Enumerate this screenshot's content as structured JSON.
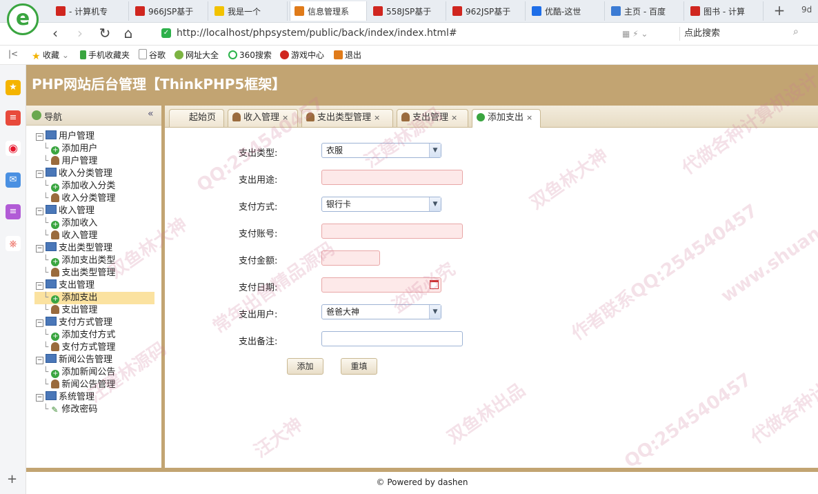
{
  "browser": {
    "tabs": [
      {
        "label": "- 计算机专",
        "color": "#d0261f",
        "active": false
      },
      {
        "label": "966JSP基于",
        "color": "#d0261f",
        "active": false
      },
      {
        "label": "我是一个",
        "color": "#f2c200",
        "active": false
      },
      {
        "label": "信息管理系",
        "color": "#e07b1a",
        "active": true
      },
      {
        "label": "558JSP基于",
        "color": "#d0261f",
        "active": false
      },
      {
        "label": "962JSP基于",
        "color": "#d0261f",
        "active": false
      },
      {
        "label": "优酷-这世",
        "color": "#1e6ee8",
        "active": false
      },
      {
        "label": "主页 - 百度",
        "color": "#3b7bd4",
        "active": false
      },
      {
        "label": "图书 - 计算",
        "color": "#d0261f",
        "active": false
      }
    ],
    "tab_extra": "9d",
    "url": "http://localhost/phpsystem/public/back/index/index.html#",
    "search_label": "点此搜索",
    "bookmarks": [
      "收藏",
      "手机收藏夹",
      "谷歌",
      "网址大全",
      "360搜索",
      "游戏中心",
      "退出"
    ]
  },
  "app": {
    "title": "PHP网站后台管理【ThinkPHP5框架】",
    "nav_title": "导航",
    "footer": "© Powered by dashen"
  },
  "tree": [
    {
      "label": "用户管理",
      "type": "group"
    },
    {
      "label": "添加用户",
      "type": "add"
    },
    {
      "label": "用户管理",
      "type": "user"
    },
    {
      "label": "收入分类管理",
      "type": "group"
    },
    {
      "label": "添加收入分类",
      "type": "add"
    },
    {
      "label": "收入分类管理",
      "type": "user"
    },
    {
      "label": "收入管理",
      "type": "group"
    },
    {
      "label": "添加收入",
      "type": "add"
    },
    {
      "label": "收入管理",
      "type": "user"
    },
    {
      "label": "支出类型管理",
      "type": "group"
    },
    {
      "label": "添加支出类型",
      "type": "add"
    },
    {
      "label": "支出类型管理",
      "type": "user"
    },
    {
      "label": "支出管理",
      "type": "group"
    },
    {
      "label": "添加支出",
      "type": "add",
      "selected": true
    },
    {
      "label": "支出管理",
      "type": "user"
    },
    {
      "label": "支付方式管理",
      "type": "group"
    },
    {
      "label": "添加支付方式",
      "type": "add"
    },
    {
      "label": "支付方式管理",
      "type": "user"
    },
    {
      "label": "新闻公告管理",
      "type": "group"
    },
    {
      "label": "添加新闻公告",
      "type": "add"
    },
    {
      "label": "新闻公告管理",
      "type": "user"
    },
    {
      "label": "系统管理",
      "type": "group"
    },
    {
      "label": "修改密码",
      "type": "pen"
    }
  ],
  "page_tabs": [
    {
      "label": "起始页",
      "closable": false,
      "icon": "none"
    },
    {
      "label": "收入管理",
      "closable": true,
      "icon": "user"
    },
    {
      "label": "支出类型管理",
      "closable": true,
      "icon": "user"
    },
    {
      "label": "支出管理",
      "closable": true,
      "icon": "user"
    },
    {
      "label": "添加支出",
      "closable": true,
      "icon": "add",
      "active": true
    }
  ],
  "form": {
    "type_label": "支出类型:",
    "type_value": "衣服",
    "purpose_label": "支出用途:",
    "purpose_value": "",
    "method_label": "支付方式:",
    "method_value": "银行卡",
    "account_label": "支付账号:",
    "account_value": "",
    "amount_label": "支付金额:",
    "amount_value": "",
    "date_label": "支付日期:",
    "date_value": "",
    "user_label": "支出用户:",
    "user_value": "爸爸大神",
    "note_label": "支出备注:",
    "note_value": "",
    "submit_label": "添加",
    "reset_label": "重填"
  },
  "watermark": [
    "QQ:254540457",
    "汪建林源码",
    "双鱼林大神",
    "代做各种计算机设计",
    "常年出售精品源码",
    "盗版必究",
    "作者联系QQ:254540457",
    "www.shuangyulin.com",
    "汪大神",
    "双鱼林出品"
  ],
  "colors": {
    "accent": "#c2a472",
    "selected": "#fbe2a0"
  }
}
